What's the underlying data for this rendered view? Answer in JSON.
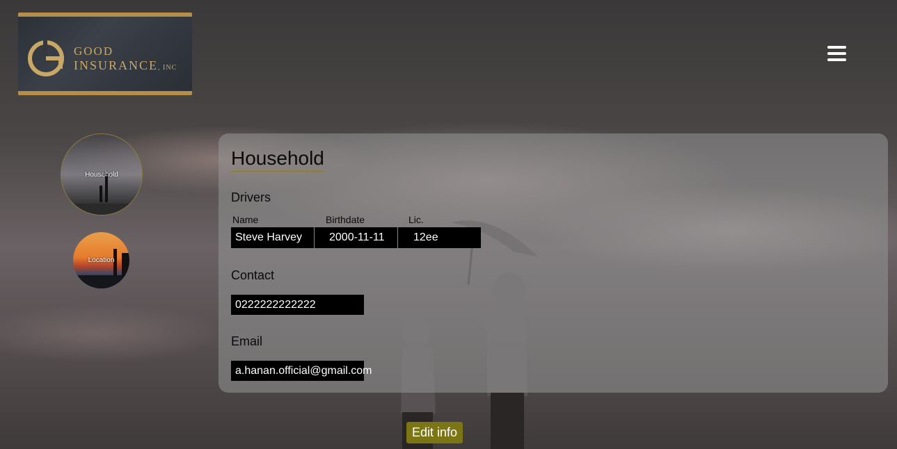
{
  "brand": {
    "line1": "GOOD",
    "line2": "INSURANCE",
    "suffix": ", INC"
  },
  "menu": {
    "icon": "hamburger-menu-icon"
  },
  "sidebar": {
    "items": [
      {
        "label": "Household"
      },
      {
        "label": "Location"
      }
    ]
  },
  "panel": {
    "title": "Household",
    "drivers": {
      "label": "Drivers",
      "columns": [
        "Name",
        "Birthdate",
        "Lic."
      ],
      "rows": [
        {
          "name": "Steve  Harvey",
          "birthdate": "2000-11-11",
          "license": "12ee"
        }
      ]
    },
    "contact": {
      "label": "Contact",
      "value": "0222222222222"
    },
    "email": {
      "label": "Email",
      "value": "a.hanan.official@gmail.com"
    }
  },
  "actions": {
    "edit_label": "Edit info"
  },
  "colors": {
    "accent": "#7b7514",
    "gold": "#b58e4a",
    "field_bg": "#000000"
  }
}
